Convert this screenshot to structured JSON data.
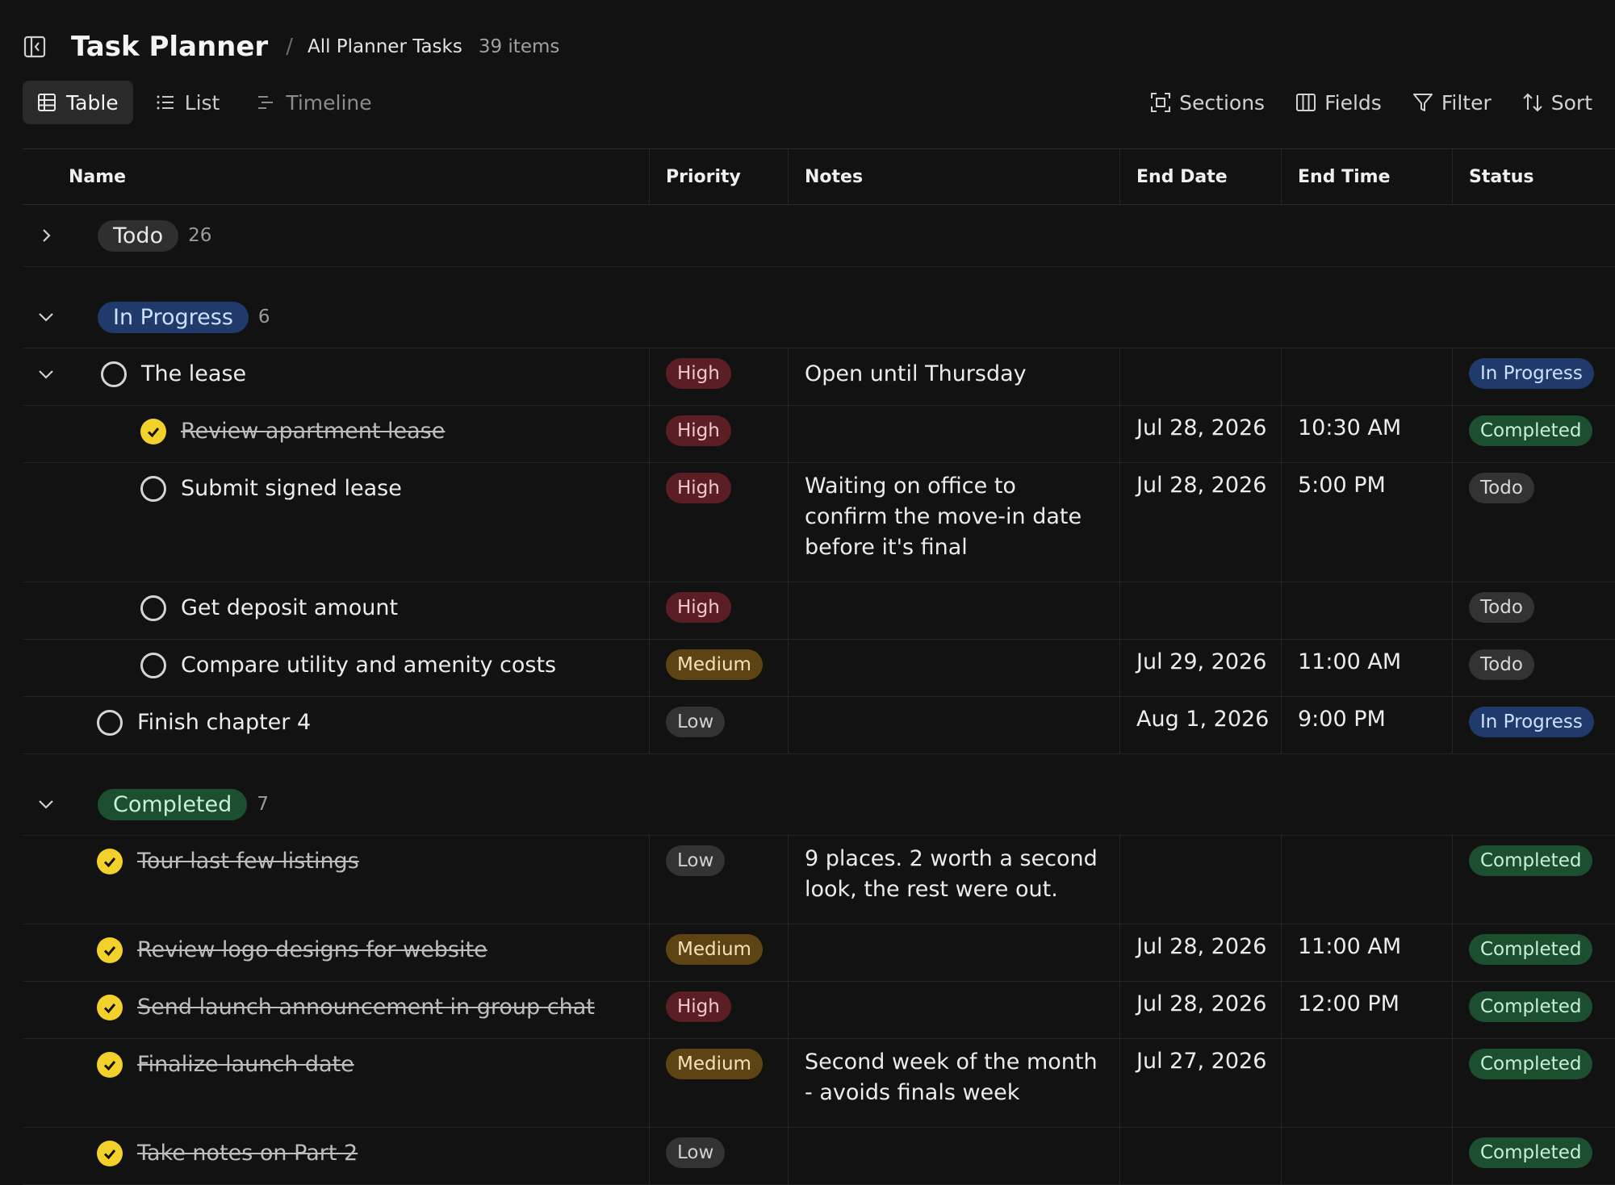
{
  "header": {
    "title": "Task Planner",
    "separator": "/",
    "breadcrumb": "All Planner Tasks",
    "item_count": "39 items"
  },
  "views": [
    {
      "label": "Table",
      "icon": "table-icon",
      "active": true
    },
    {
      "label": "List",
      "icon": "list-icon",
      "active": false
    },
    {
      "label": "Timeline",
      "icon": "timeline-icon",
      "active": false
    }
  ],
  "tools": [
    {
      "label": "Sections",
      "icon": "sections-icon"
    },
    {
      "label": "Fields",
      "icon": "fields-icon"
    },
    {
      "label": "Filter",
      "icon": "filter-icon"
    },
    {
      "label": "Sort",
      "icon": "sort-icon"
    }
  ],
  "columns": [
    "Name",
    "Priority",
    "Notes",
    "End Date",
    "End Time",
    "Status"
  ],
  "groups": {
    "todo": {
      "label": "Todo",
      "count": "26",
      "expanded": false
    },
    "in_progress": {
      "label": "In Progress",
      "count": "6",
      "expanded": true
    },
    "completed": {
      "label": "Completed",
      "count": "7",
      "expanded": true
    }
  },
  "rows": {
    "r0": {
      "name": "The lease",
      "priority": "High",
      "notes": "Open until Thursday",
      "end_date": "",
      "end_time": "",
      "status": "In Progress"
    },
    "r1": {
      "name": "Review apartment lease",
      "priority": "High",
      "notes": "",
      "end_date": "Jul 28, 2026",
      "end_time": "10:30 AM",
      "status": "Completed"
    },
    "r2": {
      "name": "Submit signed lease",
      "priority": "High",
      "notes": "Waiting on office to confirm the move-in date before it's final",
      "end_date": "Jul 28, 2026",
      "end_time": "5:00 PM",
      "status": "Todo"
    },
    "r3": {
      "name": "Get deposit amount",
      "priority": "High",
      "notes": "",
      "end_date": "",
      "end_time": "",
      "status": "Todo"
    },
    "r4": {
      "name": "Compare utility and amenity costs",
      "priority": "Medium",
      "notes": "",
      "end_date": "Jul 29, 2026",
      "end_time": "11:00 AM",
      "status": "Todo"
    },
    "r5": {
      "name": "Finish chapter 4",
      "priority": "Low",
      "notes": "",
      "end_date": "Aug 1, 2026",
      "end_time": "9:00 PM",
      "status": "In Progress"
    },
    "c0": {
      "name": "Tour last few listings",
      "priority": "Low",
      "notes": "9 places. 2 worth a second look, the rest were out.",
      "end_date": "",
      "end_time": "",
      "status": "Completed"
    },
    "c1": {
      "name": "Review logo designs for website",
      "priority": "Medium",
      "notes": "",
      "end_date": "Jul 28, 2026",
      "end_time": "11:00 AM",
      "status": "Completed"
    },
    "c2": {
      "name": "Send launch announcement in group chat",
      "priority": "High",
      "notes": "",
      "end_date": "Jul 28, 2026",
      "end_time": "12:00 PM",
      "status": "Completed"
    },
    "c3": {
      "name": "Finalize launch date",
      "priority": "Medium",
      "notes": "Second week of the month - avoids finals week",
      "end_date": "Jul 27, 2026",
      "end_time": "",
      "status": "Completed"
    },
    "c4": {
      "name": "Take notes on Part 2",
      "priority": "Low",
      "notes": "",
      "end_date": "",
      "end_time": "",
      "status": "Completed"
    }
  }
}
